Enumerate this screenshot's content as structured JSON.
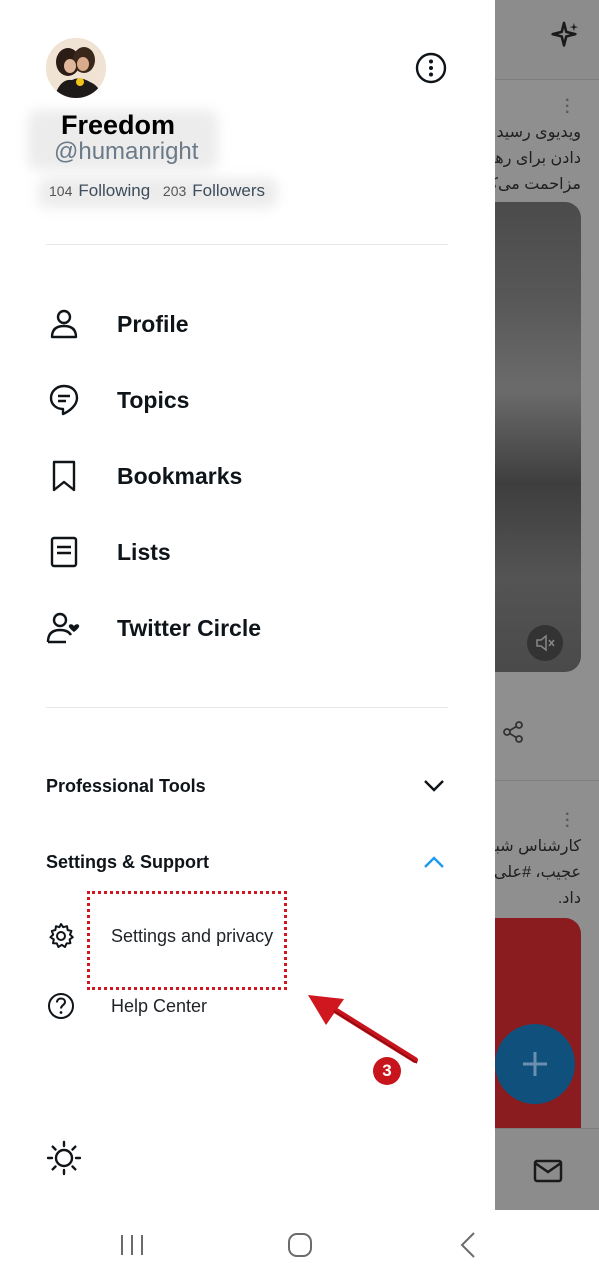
{
  "feed": {
    "tweet1_lines": [
      "ویدیوی رسید",
      "دادن برای رها",
      "مزاحمت می‌کن"
    ],
    "tweet2_lines": [
      "کارشناس شبکه",
      "عجیب، #علی",
      "داد."
    ]
  },
  "drawer": {
    "display_name": "Freedom",
    "handle": "@humanright",
    "following_count": "104",
    "following_label": "Following",
    "followers_count": "203",
    "followers_label": "Followers",
    "menu": [
      {
        "label": "Profile",
        "icon": "person-icon"
      },
      {
        "label": "Topics",
        "icon": "topics-icon"
      },
      {
        "label": "Bookmarks",
        "icon": "bookmark-icon"
      },
      {
        "label": "Lists",
        "icon": "list-icon"
      },
      {
        "label": "Twitter Circle",
        "icon": "circle-icon"
      }
    ],
    "sections": {
      "professional_tools": "Professional Tools",
      "settings_support": "Settings & Support"
    },
    "sub_items": [
      {
        "label": "Settings and privacy",
        "icon": "gear-icon"
      },
      {
        "label": "Help Center",
        "icon": "help-icon"
      }
    ]
  },
  "annotation": {
    "step_number": "3",
    "color": "#d0161e"
  },
  "colors": {
    "accent": "#1d9bf0",
    "text": "#0f1419",
    "overlay": "#8f8f8f"
  }
}
